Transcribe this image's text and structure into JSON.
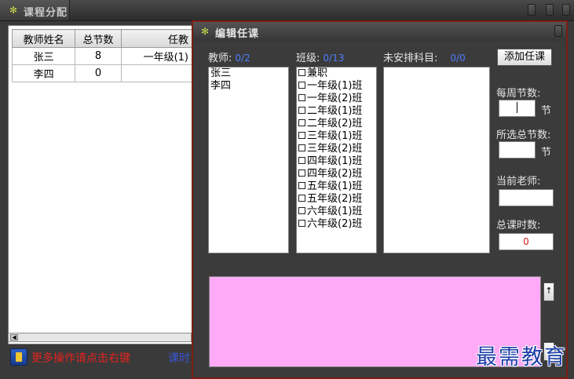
{
  "main_window": {
    "title": "课程分配",
    "table": {
      "headers": [
        "教师姓名",
        "总节数",
        "任教"
      ],
      "rows": [
        {
          "name": "张三",
          "total": "8",
          "classes": "一年级(1)"
        },
        {
          "name": "李四",
          "total": "0",
          "classes": ""
        }
      ]
    },
    "status": {
      "hint": "更多操作请点击右键",
      "hint2": "课时"
    }
  },
  "dialog": {
    "title": "编辑任课",
    "teachers": {
      "label": "教师:",
      "count": "0/2",
      "items": [
        "张三",
        "李四"
      ]
    },
    "classes": {
      "label": "班级:",
      "count": "0/13",
      "items": [
        "兼职",
        "一年级(1)班",
        "一年级(2)班",
        "二年级(1)班",
        "二年级(2)班",
        "三年级(1)班",
        "三年级(2)班",
        "四年级(1)班",
        "四年级(2)班",
        "五年级(1)班",
        "五年级(2)班",
        "六年级(1)班",
        "六年级(2)班"
      ]
    },
    "unscheduled": {
      "label": "未安排科目:",
      "count": "0/0"
    },
    "add_button": "添加任课",
    "weekly_lessons": {
      "label": "每周节数:",
      "unit": "节",
      "value": ""
    },
    "selected_total": {
      "label": "所选总节数:",
      "unit": "节",
      "value": ""
    },
    "current_teacher": {
      "label": "当前老师:",
      "value": ""
    },
    "total_hours": {
      "label": "总课时数:",
      "value": "0"
    }
  },
  "watermark": "最需教育",
  "colors": {
    "accent_count": "#4d7cff",
    "status_hint": "#e3231e",
    "pink_area": "#ffaaf7",
    "dialog_border": "#7e1d14"
  }
}
